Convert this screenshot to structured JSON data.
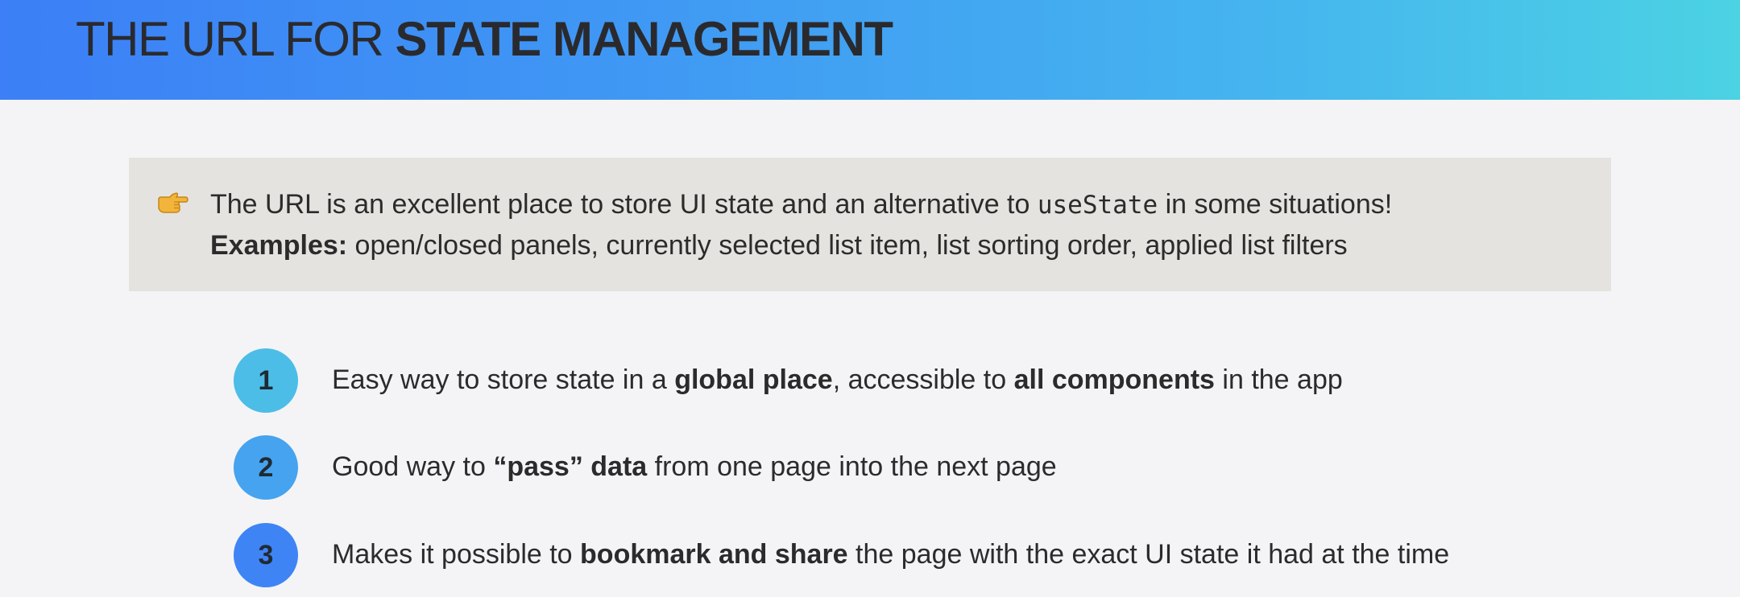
{
  "header": {
    "title_light": "THE URL FOR ",
    "title_bold": "STATE MANAGEMENT",
    "gradient_start": "#3c7ff6",
    "gradient_end": "#4bd2e3"
  },
  "callout": {
    "icon": "pointing-hand-icon",
    "line1_part1": "The URL is an excellent place to store UI state and an alternative to ",
    "line1_code": "useState",
    "line1_part2": " in some situations!",
    "line2_bold": "Examples:",
    "line2_rest": " open/closed panels, currently selected list item, list sorting order, applied list filters",
    "background": "#e5e3e0"
  },
  "points": [
    {
      "number": "1",
      "color": "#4cbde6",
      "text_a": "Easy way to store state in a ",
      "bold_a": "global place",
      "text_b": ", accessible to ",
      "bold_b": "all components",
      "text_c": " in the app"
    },
    {
      "number": "2",
      "color": "#46a3ef",
      "text_a": "Good way to ",
      "bold_a": "“pass” data",
      "text_b": " from one page into the next page"
    },
    {
      "number": "3",
      "color": "#3f84f5",
      "text_a": "Makes it possible to ",
      "bold_a": "bookmark and share",
      "text_b": " the page with the exact UI state it had at the time"
    }
  ]
}
